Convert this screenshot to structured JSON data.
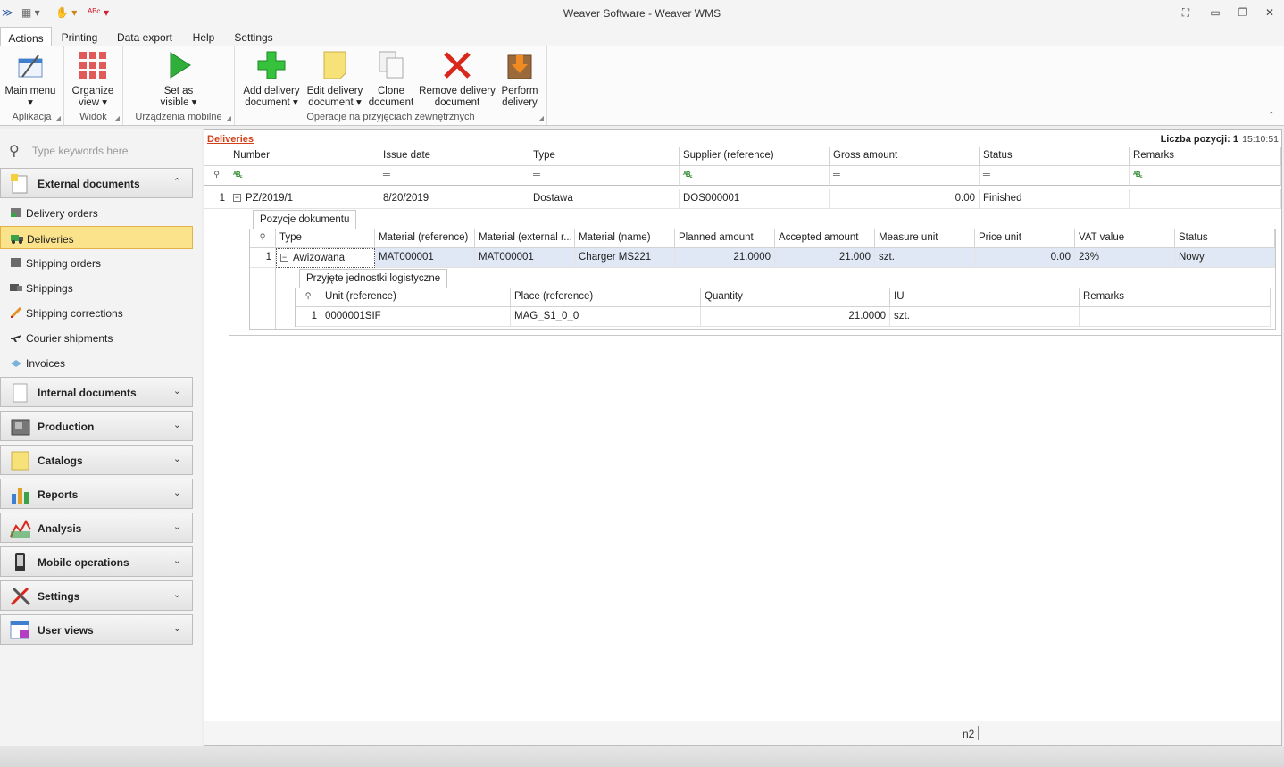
{
  "window": {
    "title": "Weaver Software - Weaver WMS"
  },
  "menu_tabs": [
    "Actions",
    "Printing",
    "Data export",
    "Help",
    "Settings"
  ],
  "ribbon": {
    "groups": [
      {
        "label": "Aplikacja",
        "buttons": [
          {
            "line1": "Main menu",
            "line2": "▾"
          }
        ]
      },
      {
        "label": "Widok",
        "buttons": [
          {
            "line1": "Organize",
            "line2": "view ▾"
          }
        ]
      },
      {
        "label": "Urządzenia mobilne",
        "buttons": [
          {
            "line1": "Set as",
            "line2": "visible ▾"
          }
        ]
      },
      {
        "label": "Operacje na przyjęciach zewnętrznych",
        "buttons": [
          {
            "line1": "Add delivery",
            "line2": "document ▾"
          },
          {
            "line1": "Edit delivery",
            "line2": "document ▾"
          },
          {
            "line1": "Clone",
            "line2": "document"
          },
          {
            "line1": "Remove delivery",
            "line2": "document"
          },
          {
            "line1": "Perform",
            "line2": "delivery"
          }
        ]
      }
    ]
  },
  "nav": {
    "search_placeholder": "Type keywords here",
    "external": {
      "label": "External documents",
      "items": [
        "Delivery orders",
        "Deliveries",
        "Shipping orders",
        "Shippings",
        "Shipping corrections",
        "Courier shipments",
        "Invoices"
      ]
    },
    "sections": [
      "Internal documents",
      "Production",
      "Catalogs",
      "Reports",
      "Analysis",
      "Mobile operations",
      "Settings",
      "User views"
    ]
  },
  "content": {
    "breadcrumb": "Deliveries",
    "count_label": "Liczba pozycji: 1",
    "time": "15:10:51",
    "columns": [
      "Number",
      "Issue date",
      "Type",
      "Supplier (reference)",
      "Gross amount",
      "Status",
      "Remarks"
    ],
    "row": {
      "index": "1",
      "number": "PZ/2019/1",
      "issue_date": "8/20/2019",
      "type": "Dostawa",
      "supplier": "DOS000001",
      "gross": "0.00",
      "status": "Finished",
      "remarks": ""
    },
    "detail": {
      "tab": "Pozycje dokumentu",
      "columns": [
        "Type",
        "Material (reference)",
        "Material (external r...",
        "Material (name)",
        "Planned amount",
        "Accepted amount",
        "Measure unit",
        "Price unit",
        "VAT value",
        "Status"
      ],
      "row": {
        "index": "1",
        "type": "Awizowana",
        "mat_ref": "MAT000001",
        "mat_ext": "MAT000001",
        "mat_name": "Charger MS221",
        "planned": "21.0000",
        "accepted": "21.000",
        "unit": "szt.",
        "price": "0.00",
        "vat": "23%",
        "status": "Nowy"
      },
      "sub": {
        "tab": "Przyjęte jednostki logistyczne",
        "columns": [
          "Unit (reference)",
          "Place (reference)",
          "Quantity",
          "IU",
          "Remarks"
        ],
        "row": {
          "index": "1",
          "unit_ref": "0000001SIF",
          "place": "MAG_S1_0_0",
          "quantity": "21.0000",
          "iu": "szt.",
          "remarks": ""
        }
      }
    }
  },
  "statusbar": {
    "user": "n2"
  }
}
